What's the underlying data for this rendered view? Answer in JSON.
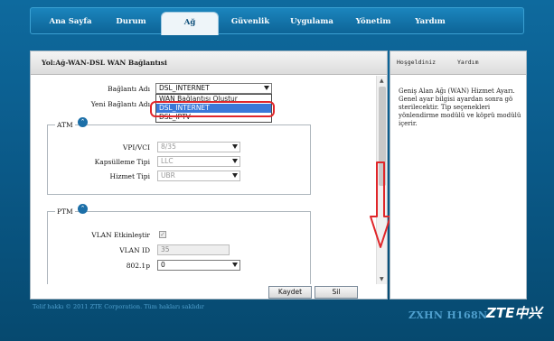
{
  "nav": {
    "items": [
      "Ana Sayfa",
      "Durum",
      "Ağ",
      "Güvenlik",
      "Uygulama",
      "Yönetim",
      "Yardım"
    ],
    "active": "Ağ"
  },
  "panel": {
    "breadcrumb": "Yol:Ağ-WAN-DSL WAN Bağlantısi",
    "connection_name_label": "Bağlantı Adı",
    "connection_name_value": "DSL_INTERNET",
    "new_connection_label": "Yeni Bağlantı Adı",
    "dropdown_options": [
      "WAN Bağlantısı Oluştur",
      "DSL_INTERNET",
      "DSL_IPTV"
    ],
    "dropdown_highlight": "DSL_INTERNET",
    "atm": {
      "title": "ATM",
      "vpi_label": "VPI/VCI",
      "vpi_value": "8/35",
      "encap_label": "Kapsülleme Tipi",
      "encap_value": "LLC",
      "service_label": "Hizmet Tipi",
      "service_value": "UBR"
    },
    "ptm": {
      "title": "PTM",
      "vlan_enable_label": "VLAN Etkinleştir",
      "vlan_enable_checked": "✓",
      "vlan_id_label": "VLAN ID",
      "vlan_id_value": "35",
      "p8021_label": "802.1p",
      "p8021_value": "0"
    },
    "save_label": "Kaydet",
    "delete_label": "Sil"
  },
  "side": {
    "tab_welcome": "Hoşgeldiniz",
    "tab_help": "Yardım",
    "description": "Geniş Alan Ağı (WAN) Hizmet Ayarı. Genel ayar bilgisi ayardan sonra gö sterilecektir. Tip seçenekleri yönlendirme modülü ve köprü modülü içerir."
  },
  "footer": {
    "copyright": "Telif hakkı © 2011 ZTE Corporation. Tüm hakları saklıdır",
    "model": "ZXHN H168N",
    "logo": "ZTE中兴"
  },
  "colors": {
    "background": "#0b5c8c",
    "highlight": "#3a78d8",
    "annotation": "#e0262a"
  }
}
